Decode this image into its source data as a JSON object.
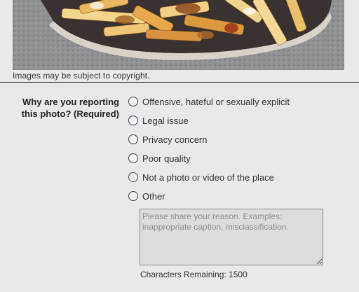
{
  "image": {
    "alt": "Photo of poutine fries with gravy",
    "caption": "Images may be subject to copyright."
  },
  "report": {
    "question": "Why are you reporting this photo? (Required)",
    "options": [
      {
        "label": "Offensive, hateful or sexually explicit",
        "selected": false
      },
      {
        "label": "Legal issue",
        "selected": false
      },
      {
        "label": "Privacy concern",
        "selected": false
      },
      {
        "label": "Poor quality",
        "selected": false
      },
      {
        "label": "Not a photo or video of the place",
        "selected": false
      },
      {
        "label": "Other",
        "selected": false
      }
    ],
    "reason_value": "",
    "reason_placeholder": "Please share your reason. Examples: inappropriate caption, misclassification.",
    "characters_remaining": "Characters Remaining: 1500"
  }
}
